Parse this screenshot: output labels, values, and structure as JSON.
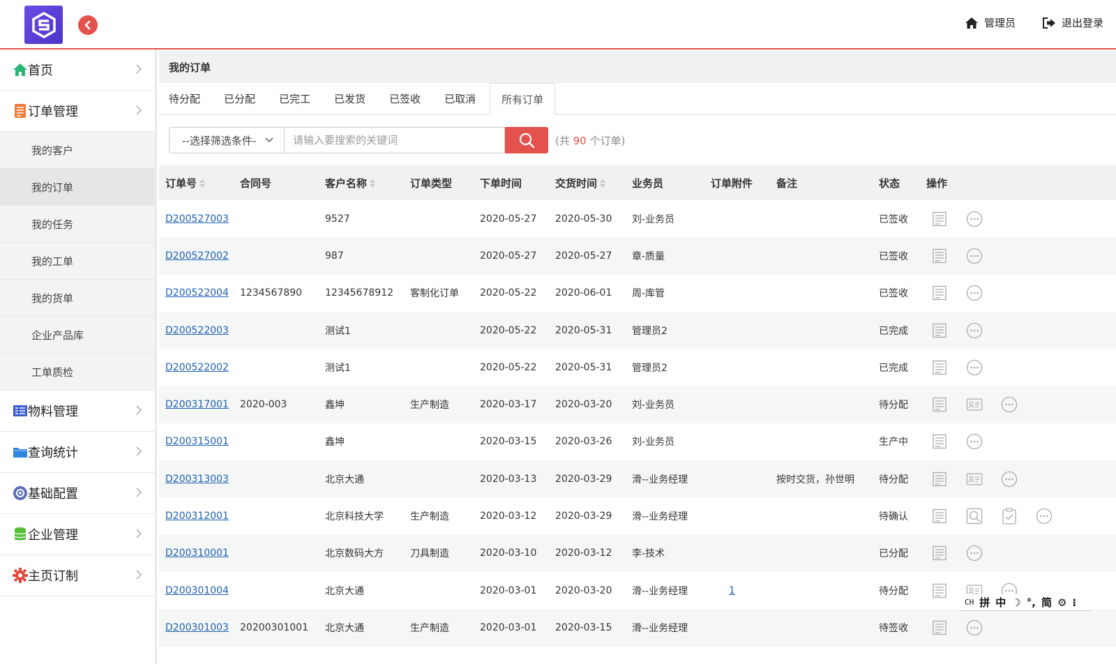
{
  "header": {
    "admin_label": "管理员",
    "logout_label": "退出登录"
  },
  "sidebar": {
    "items": [
      {
        "label": "首页",
        "icon": "home-icon"
      },
      {
        "label": "订单管理",
        "icon": "order-icon"
      },
      {
        "label": "物料管理",
        "icon": "material-icon"
      },
      {
        "label": "查询统计",
        "icon": "folder-icon"
      },
      {
        "label": "基础配置",
        "icon": "config-icon"
      },
      {
        "label": "企业管理",
        "icon": "database-icon"
      },
      {
        "label": "主页订制",
        "icon": "gear-icon"
      }
    ],
    "sub_items": [
      "我的客户",
      "我的订单",
      "我的任务",
      "我的工单",
      "我的货单",
      "企业产品库",
      "工单质检"
    ],
    "active_sub": "我的订单"
  },
  "page": {
    "title": "我的订单",
    "tabs": [
      "待分配",
      "已分配",
      "已完工",
      "已发货",
      "已签收",
      "已取消",
      "所有订单"
    ],
    "active_tab": "所有订单"
  },
  "filter": {
    "select_label": "--选择筛选条件-",
    "search_placeholder": "请输入要搜索的关键词",
    "count_prefix": "(共",
    "count": "90",
    "count_suffix": "个订单)"
  },
  "table": {
    "columns": [
      "订单号",
      "合同号",
      "客户名称",
      "订单类型",
      "下单时间",
      "交货时间",
      "业务员",
      "订单附件",
      "备注",
      "状态",
      "操作"
    ],
    "rows": [
      {
        "order": "D200527003",
        "contract": "",
        "customer": "9527",
        "type": "",
        "order_date": "2020-05-27",
        "delivery": "2020-05-30",
        "sales": "刘-业务员",
        "attach": "",
        "note": "",
        "status": "已签收",
        "ops": [
          "list",
          "more"
        ]
      },
      {
        "order": "D200527002",
        "contract": "",
        "customer": "987",
        "type": "",
        "order_date": "2020-05-27",
        "delivery": "2020-05-27",
        "sales": "章-质量",
        "attach": "",
        "note": "",
        "status": "已签收",
        "ops": [
          "list",
          "more"
        ]
      },
      {
        "order": "D200522004",
        "contract": "1234567890",
        "customer": "12345678912",
        "type": "客制化订单",
        "order_date": "2020-05-22",
        "delivery": "2020-06-01",
        "sales": "周-库管",
        "attach": "",
        "note": "",
        "status": "已签收",
        "ops": [
          "list",
          "more"
        ]
      },
      {
        "order": "D200522003",
        "contract": "",
        "customer": "测试1",
        "type": "",
        "order_date": "2020-05-22",
        "delivery": "2020-05-31",
        "sales": "管理员2",
        "attach": "",
        "note": "",
        "status": "已完成",
        "ops": [
          "list",
          "more"
        ]
      },
      {
        "order": "D200522002",
        "contract": "",
        "customer": "测试1",
        "type": "",
        "order_date": "2020-05-22",
        "delivery": "2020-05-31",
        "sales": "管理员2",
        "attach": "",
        "note": "",
        "status": "已完成",
        "ops": [
          "list",
          "more"
        ]
      },
      {
        "order": "D200317001",
        "contract": "2020-003",
        "customer": "鑫坤",
        "type": "生产制造",
        "order_date": "2020-03-17",
        "delivery": "2020-03-20",
        "sales": "刘-业务员",
        "attach": "",
        "note": "",
        "status": "待分配",
        "ops": [
          "list",
          "card",
          "more"
        ]
      },
      {
        "order": "D200315001",
        "contract": "",
        "customer": "鑫坤",
        "type": "",
        "order_date": "2020-03-15",
        "delivery": "2020-03-26",
        "sales": "刘-业务员",
        "attach": "",
        "note": "",
        "status": "生产中",
        "ops": [
          "list",
          "more"
        ]
      },
      {
        "order": "D200313003",
        "contract": "",
        "customer": "北京大通",
        "type": "",
        "order_date": "2020-03-13",
        "delivery": "2020-03-29",
        "sales": "滑--业务经理",
        "attach": "",
        "note": "按时交货，孙世明",
        "status": "待分配",
        "ops": [
          "list",
          "card",
          "more"
        ]
      },
      {
        "order": "D200312001",
        "contract": "",
        "customer": "北京科技大学",
        "type": "生产制造",
        "order_date": "2020-03-12",
        "delivery": "2020-03-29",
        "sales": "滑--业务经理",
        "attach": "",
        "note": "",
        "status": "待确认",
        "ops": [
          "list",
          "search",
          "clipboard",
          "more"
        ]
      },
      {
        "order": "D200310001",
        "contract": "",
        "customer": "北京数码大方",
        "type": "刀具制造",
        "order_date": "2020-03-10",
        "delivery": "2020-03-12",
        "sales": "李-技术",
        "attach": "",
        "note": "",
        "status": "已分配",
        "ops": [
          "list",
          "more"
        ]
      },
      {
        "order": "D200301004",
        "contract": "",
        "customer": "北京大通",
        "type": "",
        "order_date": "2020-03-01",
        "delivery": "2020-03-20",
        "sales": "滑--业务经理",
        "attach": "1",
        "note": "",
        "status": "待分配",
        "ops": [
          "list",
          "card",
          "more"
        ]
      },
      {
        "order": "D200301003",
        "contract": "20200301001",
        "customer": "北京大通",
        "type": "生产制造",
        "order_date": "2020-03-01",
        "delivery": "2020-03-15",
        "sales": "滑--业务经理",
        "attach": "",
        "note": "",
        "status": "待签收",
        "ops": [
          "list",
          "more"
        ]
      }
    ]
  },
  "ime": {
    "mode_label": "CH",
    "items": [
      "拼",
      "中",
      "简"
    ]
  },
  "colors": {
    "accent_red": "#e3524c",
    "link_blue": "#1d5fb0",
    "logo_purple": "#5a3fd6"
  }
}
